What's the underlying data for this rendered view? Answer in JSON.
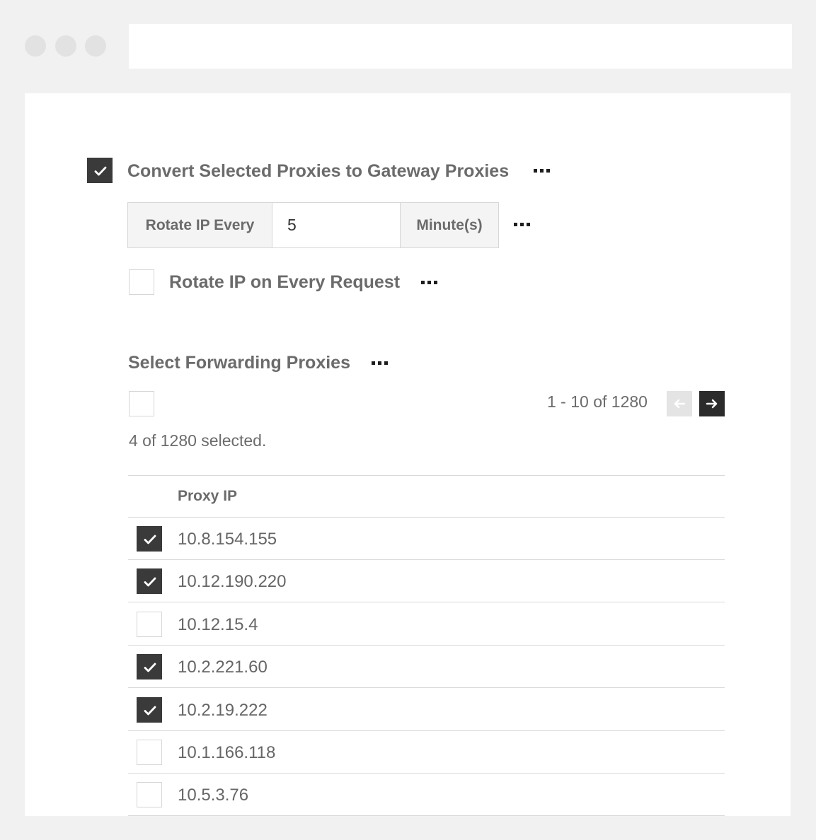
{
  "gateway": {
    "convert_checked": true,
    "convert_label": "Convert Selected Proxies to Gateway Proxies",
    "rotate_prefix": "Rotate IP Every",
    "rotate_value": "5",
    "rotate_suffix": "Minute(s)",
    "rotate_every_request_checked": false,
    "rotate_every_request_label": "Rotate IP on Every Request"
  },
  "forwarding": {
    "title": "Select Forwarding Proxies",
    "select_all_checked": false,
    "pagination": "1 - 10 of 1280",
    "selected_count": "4 of 1280 selected.",
    "column_header": "Proxy IP",
    "rows": [
      {
        "ip": "10.8.154.155",
        "checked": true
      },
      {
        "ip": "10.12.190.220",
        "checked": true
      },
      {
        "ip": "10.12.15.4",
        "checked": false
      },
      {
        "ip": "10.2.221.60",
        "checked": true
      },
      {
        "ip": "10.2.19.222",
        "checked": true
      },
      {
        "ip": "10.1.166.118",
        "checked": false
      },
      {
        "ip": "10.5.3.76",
        "checked": false
      }
    ]
  },
  "icons": {
    "window_controls": [
      "window-dot-icon",
      "window-dot-icon",
      "window-dot-icon"
    ],
    "more": "more-dots-icon",
    "prev": "arrow-left-icon",
    "next": "arrow-right-icon",
    "check": "checkmark-icon"
  },
  "colors": {
    "checked_fill": "#3a3a3a",
    "label_text": "#6b6b6b",
    "border": "#d6d6d6",
    "background": "#f1f1f1"
  }
}
